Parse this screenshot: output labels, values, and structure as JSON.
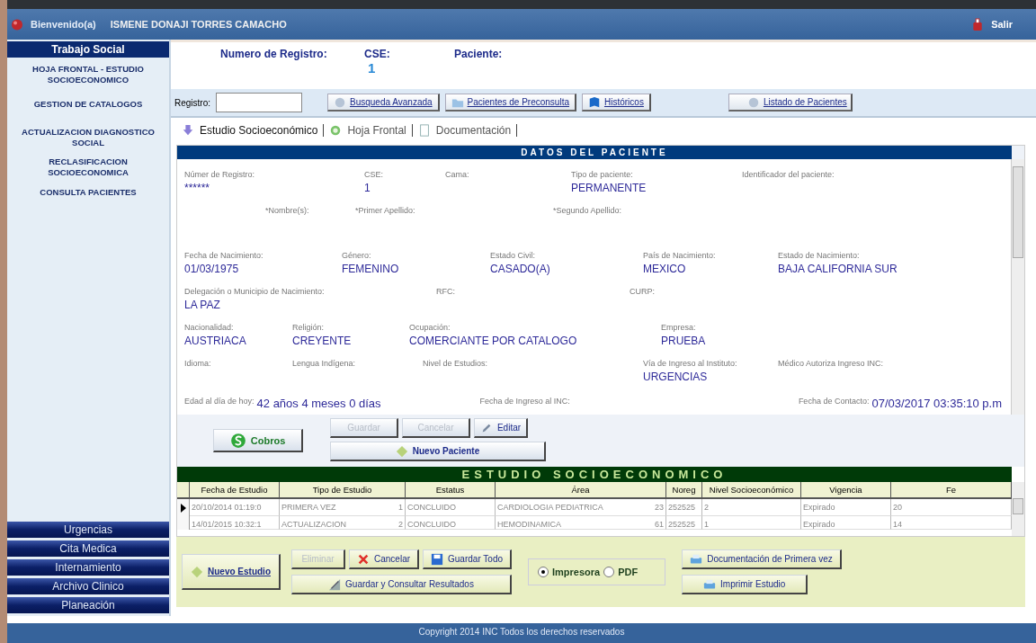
{
  "header": {
    "greeting": "Bienvenido(a)",
    "user": "ISMENE DONAJI TORRES CAMACHO",
    "logout": "Salir"
  },
  "sidebar": {
    "title": "Trabajo Social",
    "items": [
      {
        "label": "HOJA FRONTAL - ESTUDIO SOCIOECONOMICO"
      },
      {
        "label": "GESTION DE CATALOGOS"
      },
      {
        "label": "ACTUALIZACION DIAGNOSTICO SOCIAL"
      },
      {
        "label": "RECLASIFICACION SOCIOECONOMICA"
      },
      {
        "label": "CONSULTA PACIENTES"
      }
    ],
    "modules": [
      "Urgencias",
      "Cita Medica",
      "Internamiento",
      "Archivo Clinico",
      "Planeación"
    ]
  },
  "patient_header": {
    "registro_label": "Numero de Registro:",
    "cse_label": "CSE:",
    "cse_value": "1",
    "paciente_label": "Paciente:"
  },
  "toolbar": {
    "registro_label": "Registro:",
    "buttons": [
      "Busqueda Avanzada",
      "Pacientes de Preconsulta",
      "Históricos",
      "Listado de Pacientes"
    ]
  },
  "tabs": [
    {
      "label": "Estudio Socioeconómico",
      "selected": true
    },
    {
      "label": "Hoja Frontal",
      "selected": false
    },
    {
      "label": "Documentación",
      "selected": false
    }
  ],
  "patient_data": {
    "title": "DATOS DEL PACIENTE",
    "rows": [
      [
        {
          "label": "Númer de Registro:",
          "value": "******"
        },
        {
          "label": "CSE:",
          "value": "1"
        },
        {
          "label": "Cama:"
        },
        {
          "label": "Tipo de paciente:",
          "value": "PERMANENTE"
        },
        {
          "label": "Identificador del paciente:"
        }
      ],
      [
        {
          "label": "*Nombre(s):"
        },
        {
          "label": "*Primer Apellido:"
        },
        {
          "label": "*Segundo Apellido:"
        }
      ],
      [
        {
          "label": "Fecha de Nacimiento:",
          "value": "01/03/1975"
        },
        {
          "label": "Género:",
          "value": "FEMENINO"
        },
        {
          "label": "Estado Civil:",
          "value": "CASADO(A)"
        },
        {
          "label": "País de Nacimiento:",
          "value": "MEXICO"
        },
        {
          "label": "Estado de Nacimiento:",
          "value": "BAJA CALIFORNIA SUR"
        }
      ],
      [
        {
          "label": "Delegación o Municipio de Nacimiento:",
          "value": "LA PAZ"
        },
        {
          "label": "RFC:"
        },
        {
          "label": "CURP:"
        }
      ],
      [
        {
          "label": "Nacionalidad:",
          "value": "AUSTRIACA"
        },
        {
          "label": "Religión:",
          "value": "CREYENTE"
        },
        {
          "label": "Ocupación:",
          "value": "COMERCIANTE POR CATALOGO"
        },
        {
          "label": "Empresa:",
          "value": "PRUEBA"
        }
      ],
      [
        {
          "label": "Idioma:"
        },
        {
          "label": "Lengua Indígena:"
        },
        {
          "label": "Nivel de Estudios:"
        },
        {
          "label": "Vía de Ingreso al Instituto:",
          "value": "URGENCIAS"
        },
        {
          "label": "Médico Autoriza Ingreso INC:"
        }
      ]
    ],
    "footer_fields": [
      {
        "label": "Edad al día de hoy:",
        "value": "42 años 4 meses 0 días"
      },
      {
        "label": "Fecha de Ingreso al INC:"
      },
      {
        "label": "Fecha de Contacto:",
        "value": "07/03/2017 03:35:10 p.m"
      }
    ]
  },
  "actions": {
    "cobros": "Cobros",
    "guardar": {
      "label": "Guardar",
      "disabled": true
    },
    "cancelar": {
      "label": "Cancelar",
      "disabled": true
    },
    "editar": {
      "label": "Editar",
      "disabled": false
    },
    "nuevo_paciente": "Nuevo Paciente"
  },
  "studies": {
    "title": "ESTUDIO SOCIOECONOMICO",
    "columns": [
      "Fecha de Estudio",
      "Tipo de Estudio",
      "Estatus",
      "Área",
      "Noreg",
      "Nivel Socioeconómico",
      "Vigencia",
      "Fe"
    ],
    "rows": [
      {
        "selected": true,
        "cells": [
          "20/10/2014 01:19:0",
          "PRIMERA VEZ",
          "CONCLUIDO",
          "CARDIOLOGIA PEDIATRICA",
          "252525",
          "2",
          "Expirado",
          "20"
        ],
        "tipo_code": "1",
        "area_code": "23"
      },
      {
        "selected": false,
        "cells": [
          "14/01/2015 10:32:1",
          "ACTUALIZACION",
          "CONCLUIDO",
          "HEMODINAMICA",
          "252525",
          "1",
          "Expirado",
          "14"
        ],
        "tipo_code": "2",
        "area_code": "61"
      }
    ]
  },
  "bottom": {
    "nuevo_estudio": "Nuevo Estudio",
    "eliminar": {
      "label": "Eliminar",
      "disabled": true
    },
    "cancelar": {
      "label": "Cancelar",
      "disabled": false
    },
    "guardar_todo": "Guardar Todo",
    "guardar_consultar": "Guardar y Consultar Resultados",
    "output": [
      {
        "label": "Impresora",
        "selected": true
      },
      {
        "label": "PDF",
        "selected": false
      }
    ],
    "documentacion": "Documentación de Primera vez",
    "imprimir": "Imprimir Estudio"
  },
  "footer": "Copyright 2014 INC Todos los derechos reservados"
}
